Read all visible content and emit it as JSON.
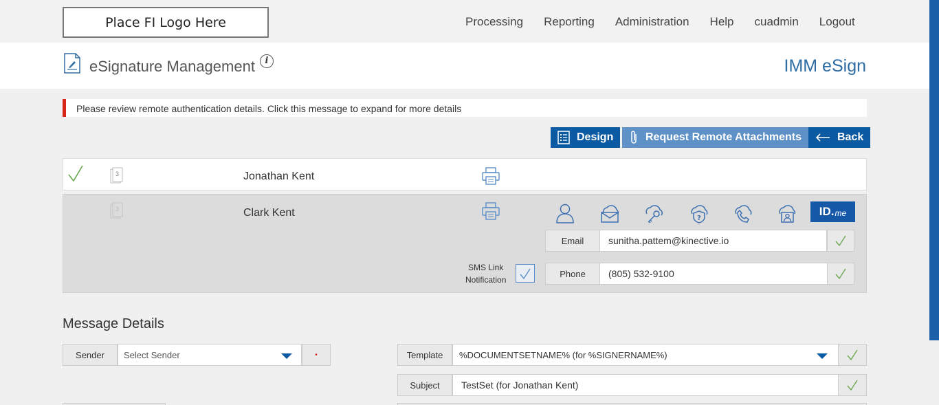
{
  "logo": "Place FI Logo Here",
  "nav": [
    "Processing",
    "Reporting",
    "Administration",
    "Help",
    "cuadmin",
    "Logout"
  ],
  "header": {
    "title": "eSignature Management",
    "info": "i",
    "brand": "IMM eSign"
  },
  "alert": "Please review remote authentication details. Click this message to expand for more details",
  "buttons": {
    "design": "Design",
    "remote": "Request Remote Attachments",
    "back": "Back"
  },
  "signers": [
    {
      "name": "Jonathan Kent",
      "doc_count": "3"
    },
    {
      "name": "Clark Kent",
      "doc_count": "3"
    }
  ],
  "auth": {
    "idme": "ID.",
    "idme_suffix": "me",
    "email_label": "Email",
    "email_value": "sunitha.pattem@kinective.io",
    "phone_label": "Phone",
    "phone_value": "(805) 532-9100",
    "sms_line1": "SMS Link",
    "sms_line2": "Notification"
  },
  "message": {
    "heading": "Message Details",
    "sender_label": "Sender",
    "sender_placeholder": "Select Sender",
    "template_label": "Template",
    "template_value": "%DOCUMENTSETNAME% (for %SIGNERNAME%)",
    "subject_label": "Subject",
    "subject_value": "TestSet (for Jonathan Kent)"
  },
  "colors": {
    "accent": "#0b5aa2",
    "alert": "#d9261c",
    "check": "#6aa84f",
    "brand": "#2e6da4"
  }
}
